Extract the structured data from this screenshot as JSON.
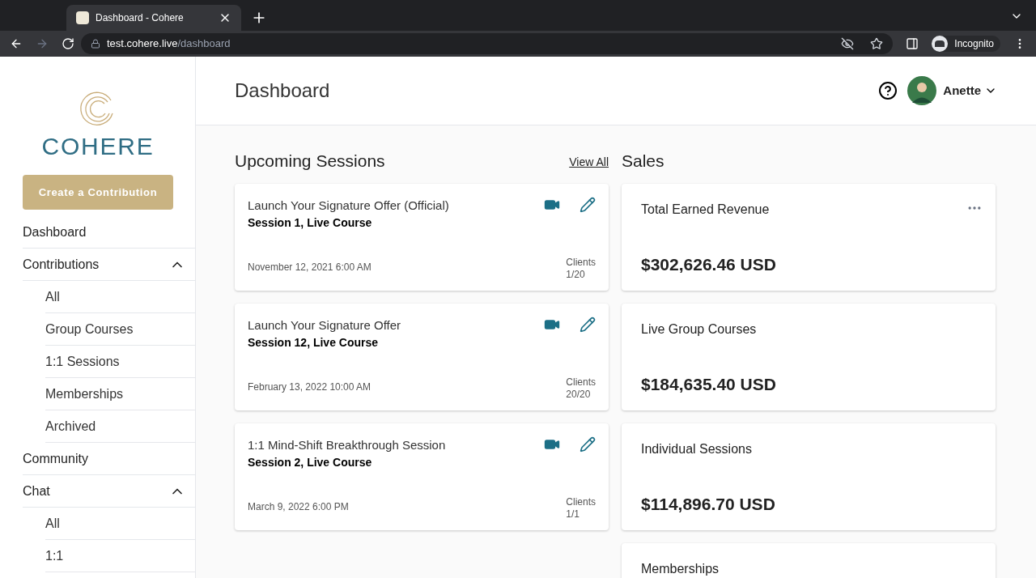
{
  "browser": {
    "tab_title": "Dashboard - Cohere",
    "url_host": "test.cohere.live",
    "url_path": "/dashboard",
    "profile": "Incognito"
  },
  "sidebar": {
    "logo": "COHERE",
    "create_button": "Create a Contribution",
    "items": [
      {
        "label": "Dashboard"
      },
      {
        "label": "Contributions",
        "expanded": true,
        "children": [
          {
            "label": "All"
          },
          {
            "label": "Group Courses"
          },
          {
            "label": "1:1 Sessions"
          },
          {
            "label": "Memberships"
          },
          {
            "label": "Archived"
          }
        ]
      },
      {
        "label": "Community"
      },
      {
        "label": "Chat",
        "expanded": true,
        "children": [
          {
            "label": "All"
          },
          {
            "label": "1:1"
          }
        ]
      }
    ]
  },
  "header": {
    "title": "Dashboard",
    "user": "Anette"
  },
  "upcoming": {
    "title": "Upcoming Sessions",
    "view_all": "View All",
    "sessions": [
      {
        "title": "Launch Your Signature Offer (Official)",
        "subtitle": "Session 1, Live Course",
        "date": "November 12, 2021 6:00 AM",
        "clients_label": "Clients",
        "clients": "1/20"
      },
      {
        "title": "Launch Your Signature Offer",
        "subtitle": "Session 12, Live Course",
        "date": "February 13, 2022 10:00 AM",
        "clients_label": "Clients",
        "clients": "20/20"
      },
      {
        "title": "1:1 Mind-Shift Breakthrough Session",
        "subtitle": "Session 2, Live Course",
        "date": "March 9, 2022 6:00 PM",
        "clients_label": "Clients",
        "clients": "1/1"
      }
    ]
  },
  "sales": {
    "title": "Sales",
    "cards": [
      {
        "label": "Total Earned Revenue",
        "amount": "$302,626.46 USD",
        "menu": true
      },
      {
        "label": "Live Group Courses",
        "amount": "$184,635.40 USD",
        "menu": false
      },
      {
        "label": "Individual Sessions",
        "amount": "$114,896.70 USD",
        "menu": false
      },
      {
        "label": "Memberships",
        "menu": false
      }
    ]
  }
}
